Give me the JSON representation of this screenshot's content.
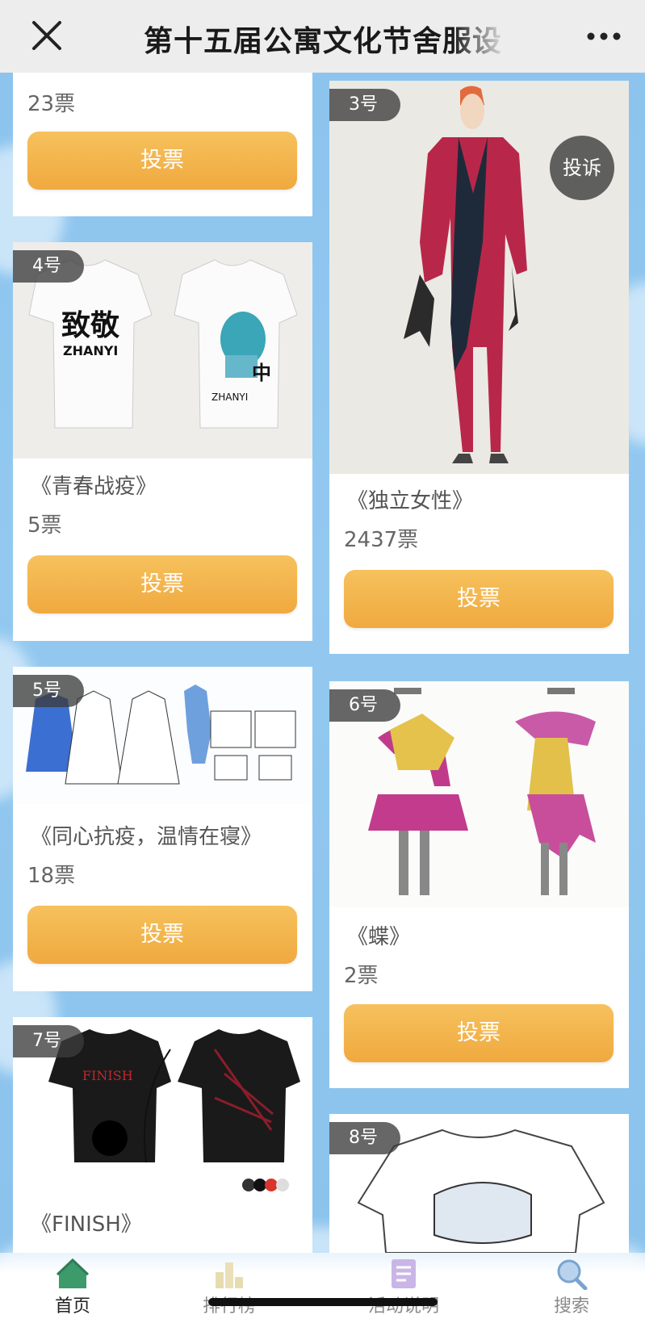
{
  "header": {
    "title": "第十五届公寓文化节舍服设",
    "close_icon": "close-icon",
    "more_icon": "more-icon"
  },
  "cards": {
    "c2": {
      "votes": "23票",
      "vote_label": "投票"
    },
    "c3": {
      "number": "3号",
      "name": "《独立女性》",
      "votes": "2437票",
      "vote_label": "投票",
      "complain_label": "投诉"
    },
    "c4": {
      "number": "4号",
      "name": "《青春战疫》",
      "votes": "5票",
      "vote_label": "投票"
    },
    "c5": {
      "number": "5号",
      "name": "《同心抗疫，温情在寝》",
      "votes": "18票",
      "vote_label": "投票"
    },
    "c6": {
      "number": "6号",
      "name": "《蝶》",
      "votes": "2票",
      "vote_label": "投票"
    },
    "c7": {
      "number": "7号",
      "name": "《FINISH》",
      "shirt_text": "FINISH"
    },
    "c8": {
      "number": "8号"
    }
  },
  "tabs": [
    {
      "label": "首页",
      "icon": "home-icon",
      "active": true
    },
    {
      "label": "排行榜",
      "icon": "ranking-icon",
      "active": false
    },
    {
      "label": "活动说明",
      "icon": "document-icon",
      "active": false
    },
    {
      "label": "搜索",
      "icon": "search-icon",
      "active": false
    }
  ],
  "colors": {
    "accent": "#f2ae44",
    "background": "#8fc6ef",
    "tab_active": "#222222",
    "tab_inactive": "#8a8a8a"
  }
}
